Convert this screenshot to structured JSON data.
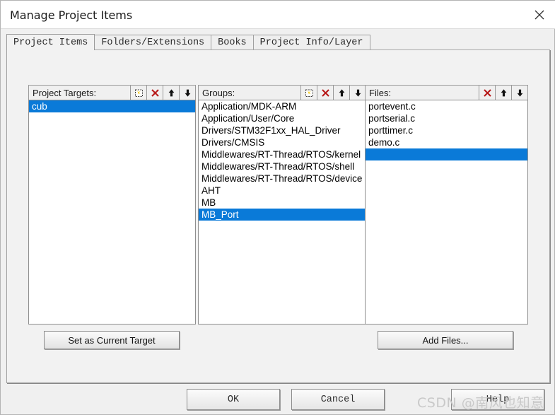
{
  "window": {
    "title": "Manage Project Items",
    "close_icon": "close-icon"
  },
  "tabs": [
    {
      "label": "Project Items",
      "active": true
    },
    {
      "label": "Folders/Extensions",
      "active": false
    },
    {
      "label": "Books",
      "active": false
    },
    {
      "label": "Project Info/Layer",
      "active": false
    }
  ],
  "panels": {
    "targets": {
      "label": "Project Targets:",
      "tools": [
        {
          "icon": "new-item-icon",
          "title": "New (Insert)"
        },
        {
          "icon": "delete-x-icon",
          "title": "Remove"
        },
        {
          "icon": "move-up-icon",
          "title": "Move Up"
        },
        {
          "icon": "move-down-icon",
          "title": "Move Down"
        }
      ],
      "items": [
        {
          "label": "cub",
          "selected": true
        }
      ]
    },
    "groups": {
      "label": "Groups:",
      "tools": [
        {
          "icon": "new-item-icon",
          "title": "New (Insert)"
        },
        {
          "icon": "delete-x-icon",
          "title": "Remove"
        },
        {
          "icon": "move-up-icon",
          "title": "Move Up"
        },
        {
          "icon": "move-down-icon",
          "title": "Move Down"
        }
      ],
      "items": [
        {
          "label": "Application/MDK-ARM",
          "selected": false
        },
        {
          "label": "Application/User/Core",
          "selected": false
        },
        {
          "label": "Drivers/STM32F1xx_HAL_Driver",
          "selected": false
        },
        {
          "label": "Drivers/CMSIS",
          "selected": false
        },
        {
          "label": "Middlewares/RT-Thread/RTOS/kernel",
          "selected": false
        },
        {
          "label": "Middlewares/RT-Thread/RTOS/shell",
          "selected": false
        },
        {
          "label": "Middlewares/RT-Thread/RTOS/device",
          "selected": false
        },
        {
          "label": "AHT",
          "selected": false
        },
        {
          "label": "MB",
          "selected": false
        },
        {
          "label": "MB_Port",
          "selected": true
        }
      ]
    },
    "files": {
      "label": "Files:",
      "tools": [
        {
          "icon": "delete-x-icon",
          "title": "Remove"
        },
        {
          "icon": "move-up-icon",
          "title": "Move Up"
        },
        {
          "icon": "move-down-icon",
          "title": "Move Down"
        }
      ],
      "items": [
        {
          "label": "portevent.c",
          "selected": false
        },
        {
          "label": "portserial.c",
          "selected": false
        },
        {
          "label": "porttimer.c",
          "selected": false
        },
        {
          "label": "demo.c",
          "selected": false
        },
        {
          "label": "",
          "selected": true
        }
      ]
    }
  },
  "actions": {
    "set_current_target": "Set as Current Target",
    "add_files": "Add Files..."
  },
  "footer": {
    "ok": "OK",
    "cancel": "Cancel",
    "help": "Help"
  },
  "watermark": {
    "text": "CSDN @南风也知意"
  },
  "colors": {
    "selection_blue": "#0a7ad8",
    "delete_red": "#b81c1c",
    "dialog_bg": "#f0f0f0",
    "page_bg": "#f2f2f2",
    "list_bg": "#ffffff"
  }
}
